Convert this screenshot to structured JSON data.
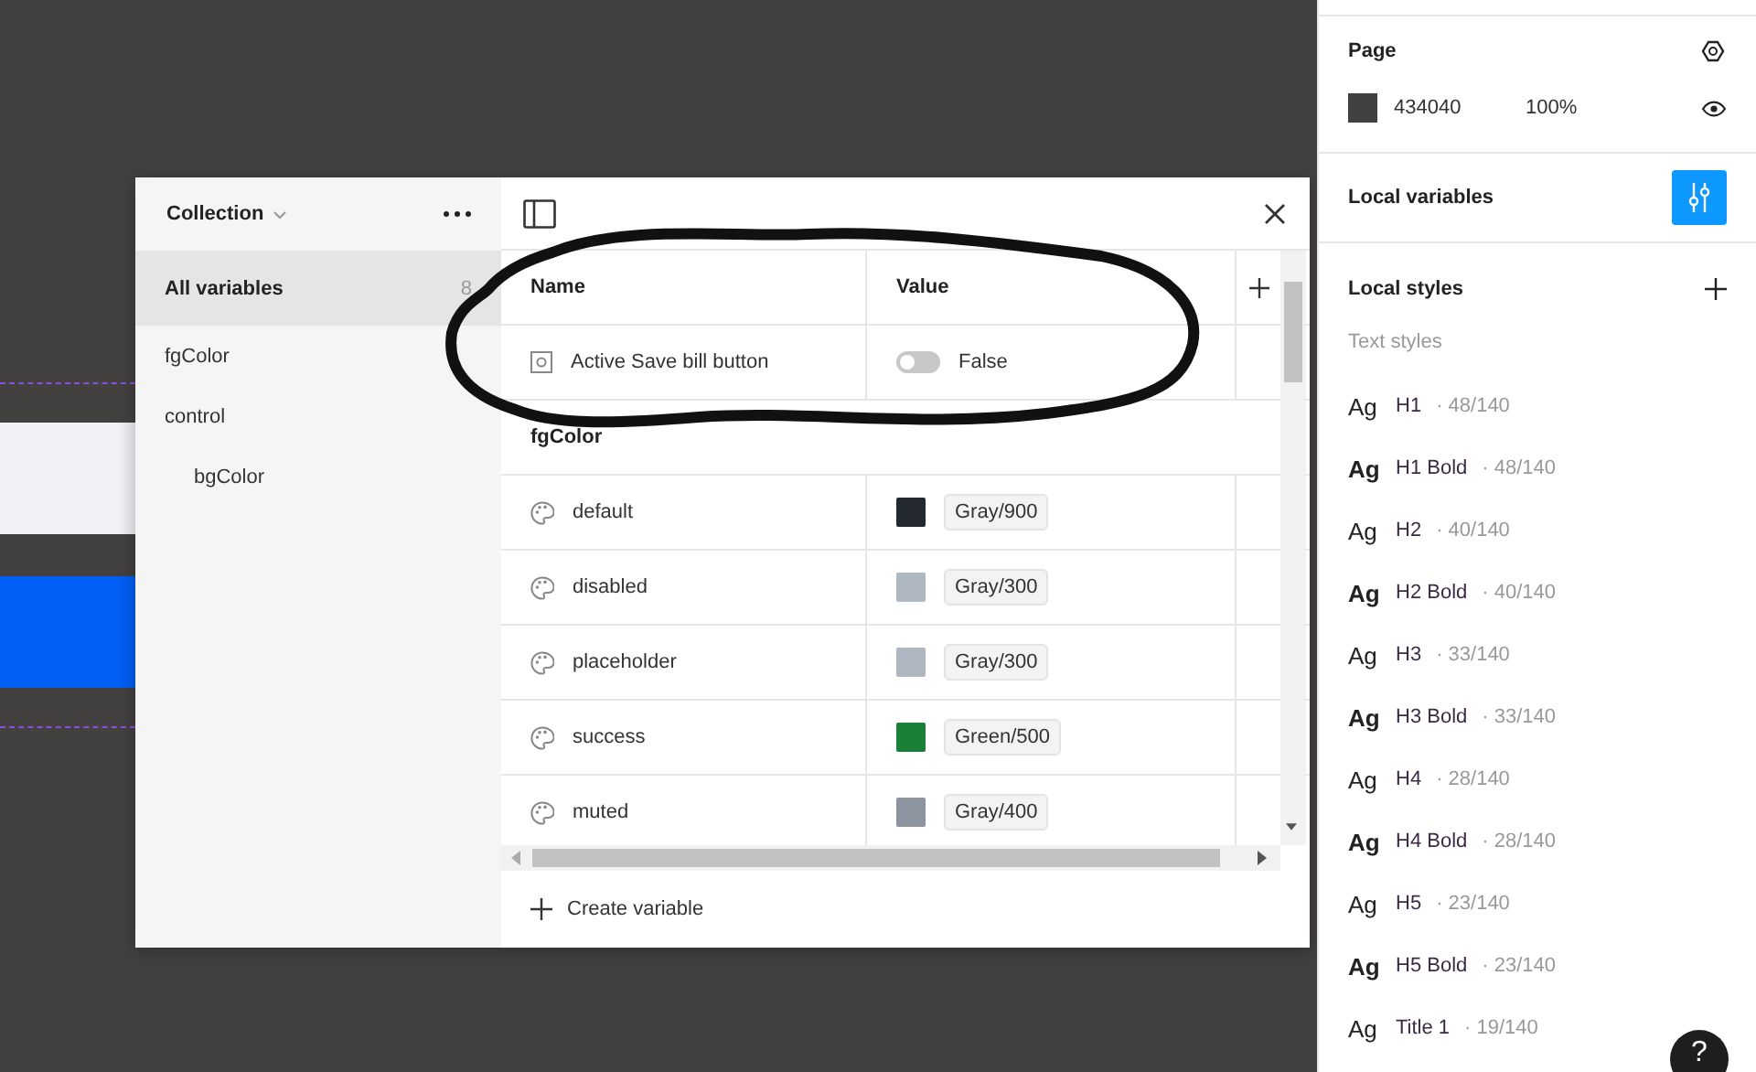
{
  "canvas": {
    "shapes": [
      {
        "kind": "guide"
      },
      {
        "kind": "light-bar"
      },
      {
        "kind": "blue-bar"
      },
      {
        "kind": "guide"
      }
    ]
  },
  "variables_dialog": {
    "collection": "Collection",
    "groups": [
      {
        "label": "All variables",
        "count": "8",
        "selected": true
      },
      {
        "label": "fgColor",
        "selected": false
      },
      {
        "label": "control",
        "selected": false,
        "children": [
          {
            "label": "bgColor",
            "selected": false
          }
        ]
      }
    ],
    "columns": [
      "Name",
      "Value"
    ],
    "rows": [
      {
        "kind": "boolean",
        "name": "Active Save bill button",
        "on": false,
        "value": "False"
      },
      {
        "kind": "group",
        "name": "fgColor"
      },
      {
        "kind": "color",
        "name": "default",
        "color": "#24292f",
        "value": "Gray/900"
      },
      {
        "kind": "color",
        "name": "disabled",
        "color": "#afb8c1",
        "value": "Gray/300"
      },
      {
        "kind": "color",
        "name": "placeholder",
        "color": "#afb8c1",
        "value": "Gray/300"
      },
      {
        "kind": "color",
        "name": "success",
        "color": "#1a7f37",
        "value": "Green/500"
      },
      {
        "kind": "color",
        "name": "muted",
        "color": "#8c959f",
        "value": "Gray/400"
      }
    ],
    "create_label": "Create variable",
    "annotation": {
      "kind": "freehand-loop"
    }
  },
  "side_panel": {
    "page": {
      "title": "Page",
      "color": "#434040",
      "hex": "434040",
      "opacity": "100%"
    },
    "local_variables": "Local variables",
    "local_styles": "Local styles",
    "text_styles_heading": "Text styles",
    "text_styles": [
      {
        "sample": "Ag",
        "name": "H1",
        "spec": "· 48/140",
        "bold": false
      },
      {
        "sample": "Ag",
        "name": "H1 Bold",
        "spec": "· 48/140",
        "bold": true
      },
      {
        "sample": "Ag",
        "name": "H2",
        "spec": "· 40/140",
        "bold": false
      },
      {
        "sample": "Ag",
        "name": "H2 Bold",
        "spec": "· 40/140",
        "bold": true
      },
      {
        "sample": "Ag",
        "name": "H3",
        "spec": "· 33/140",
        "bold": false
      },
      {
        "sample": "Ag",
        "name": "H3 Bold",
        "spec": "· 33/140",
        "bold": true
      },
      {
        "sample": "Ag",
        "name": "H4",
        "spec": "· 28/140",
        "bold": false
      },
      {
        "sample": "Ag",
        "name": "H4 Bold",
        "spec": "· 28/140",
        "bold": true
      },
      {
        "sample": "Ag",
        "name": "H5",
        "spec": "· 23/140",
        "bold": false
      },
      {
        "sample": "Ag",
        "name": "H5 Bold",
        "spec": "· 23/140",
        "bold": true
      },
      {
        "sample": "Ag",
        "name": "Title 1",
        "spec": "· 19/140",
        "bold": false
      }
    ],
    "help": "?"
  }
}
